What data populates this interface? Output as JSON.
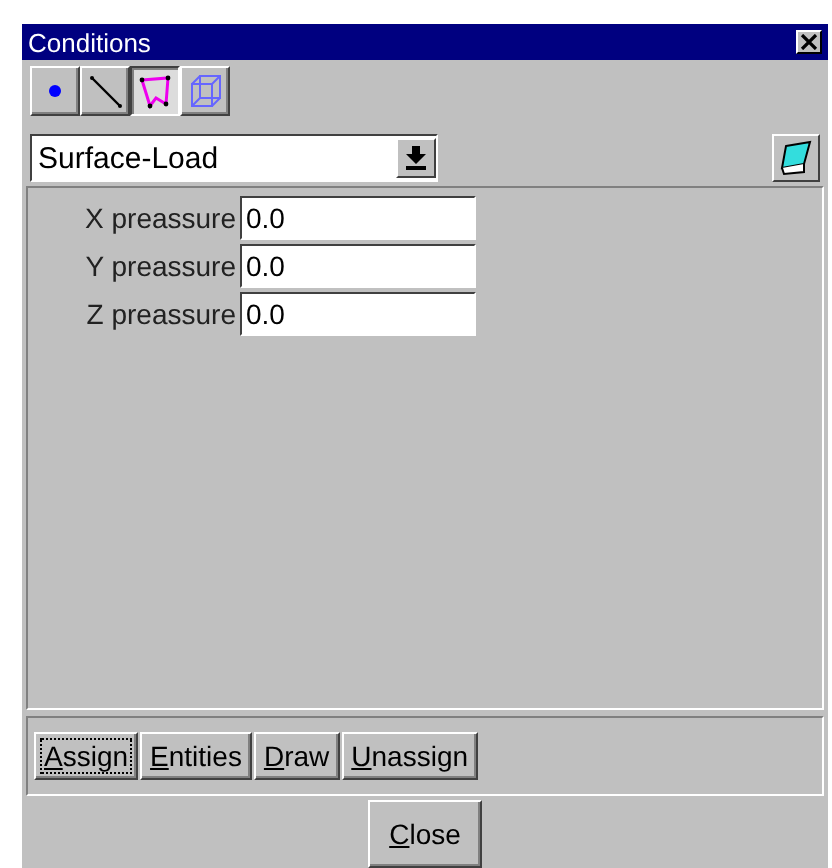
{
  "window": {
    "title": "Conditions"
  },
  "entity_tools": [
    {
      "kind": "point",
      "selected": false
    },
    {
      "kind": "line",
      "selected": false
    },
    {
      "kind": "surface",
      "selected": true
    },
    {
      "kind": "volume",
      "selected": false
    }
  ],
  "condition": {
    "value": "Surface-Load"
  },
  "fields": [
    {
      "label": "X preassure",
      "value": "0.0"
    },
    {
      "label": "Y preassure",
      "value": "0.0"
    },
    {
      "label": "Z preassure",
      "value": "0.0"
    }
  ],
  "buttons": [
    {
      "label": "Assign",
      "focused": true
    },
    {
      "label": "Entities",
      "focused": false
    },
    {
      "label": "Draw",
      "focused": false
    },
    {
      "label": "Unassign",
      "focused": false
    }
  ],
  "close_button": "Close"
}
